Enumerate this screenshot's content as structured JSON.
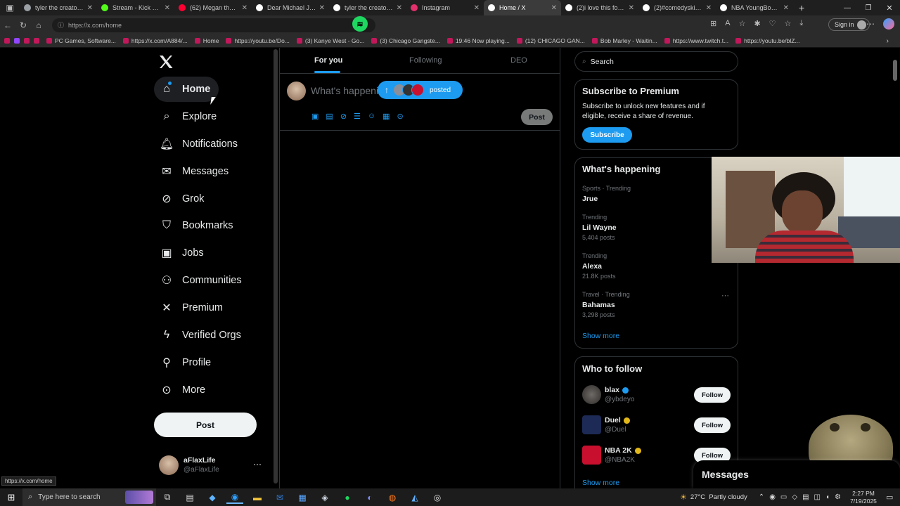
{
  "browser": {
    "tabs": [
      {
        "label": "tyler the creator do",
        "color": "#9aa0a6"
      },
      {
        "label": "Stream - Kick Dashb",
        "color": "#53fc18"
      },
      {
        "label": "(62) Megan thee st",
        "color": "#ff0033"
      },
      {
        "label": "Dear Michael Jacks",
        "color": "#ffffff"
      },
      {
        "label": "tyler the creator do",
        "color": "#ffffff"
      },
      {
        "label": "Instagram",
        "color": "#e1306c"
      },
      {
        "label": "Home / X",
        "color": "#ffffff",
        "active": true
      },
      {
        "label": "(2)i love this for him",
        "color": "#ffffff"
      },
      {
        "label": "(2)#comedyskits #",
        "color": "#ffffff"
      },
      {
        "label": "NBA YoungBoy vs F",
        "color": "#ffffff"
      }
    ],
    "url": "https://x.com/home",
    "sign_in": "Sign in",
    "bookmarks": [
      "PC Games, Software...",
      "https://x.com/A884/...",
      "Home",
      "https://youtu.be/Do...",
      "(3) Kanye West - Go...",
      "(3) Chicago Gangste...",
      "19:46 Now playing...",
      "(12) CHICAGO GAN...",
      "Bob Marley - Waitin...",
      "https://www.twitch.t...",
      "https://youtu.be/blZ..."
    ],
    "status_url": "https://x.com/home"
  },
  "sidebar": {
    "items": [
      {
        "label": "Home",
        "icon": "home-icon"
      },
      {
        "label": "Explore",
        "icon": "search-icon"
      },
      {
        "label": "Notifications",
        "icon": "bell-icon"
      },
      {
        "label": "Messages",
        "icon": "envelope-icon"
      },
      {
        "label": "Grok",
        "icon": "grok-icon"
      },
      {
        "label": "Bookmarks",
        "icon": "bookmark-icon"
      },
      {
        "label": "Jobs",
        "icon": "briefcase-icon"
      },
      {
        "label": "Communities",
        "icon": "people-icon"
      },
      {
        "label": "Premium",
        "icon": "x-logo-icon"
      },
      {
        "label": "Verified Orgs",
        "icon": "lightning-icon"
      },
      {
        "label": "Profile",
        "icon": "person-icon"
      },
      {
        "label": "More",
        "icon": "more-circle-icon"
      }
    ],
    "post_button": "Post",
    "account": {
      "name": "aFlaxLife",
      "handle": "@aFlaxLife"
    }
  },
  "feed": {
    "tabs": [
      "For you",
      "Following",
      "DEO"
    ],
    "composer_placeholder": "What's happening?",
    "posted_pill": "posted",
    "post_button": "Post"
  },
  "right": {
    "search_placeholder": "Search",
    "premium": {
      "title": "Subscribe to Premium",
      "body": "Subscribe to unlock new features and if eligible, receive a share of revenue.",
      "button": "Subscribe"
    },
    "happening": {
      "title": "What's happening",
      "trends": [
        {
          "context": "Sports · Trending",
          "name": "Jrue",
          "posts": ""
        },
        {
          "context": "Trending",
          "name": "Lil Wayne",
          "posts": "5,404 posts"
        },
        {
          "context": "Trending",
          "name": "Alexa",
          "posts": "21.8K posts"
        },
        {
          "context": "Travel · Trending",
          "name": "Bahamas",
          "posts": "3,298 posts"
        }
      ],
      "show_more": "Show more"
    },
    "follow": {
      "title": "Who to follow",
      "accounts": [
        {
          "name": "blax",
          "handle": "@ybdeyo",
          "badge": "#1d9bf0"
        },
        {
          "name": "Duel",
          "handle": "@Duel",
          "badge": "#e2b719"
        },
        {
          "name": "NBA 2K",
          "handle": "@NBA2K",
          "badge": "#e2b719"
        }
      ],
      "button": "Follow",
      "show_more": "Show more"
    },
    "messages_drawer": "Messages"
  },
  "taskbar": {
    "search_placeholder": "Type here to search",
    "weather": "27°C  Partly cloudy",
    "time": "2:27 PM",
    "date": "7/19/2025"
  },
  "colors": {
    "accent": "#1d9bf0",
    "bg": "#000000",
    "border": "#2f3336"
  }
}
